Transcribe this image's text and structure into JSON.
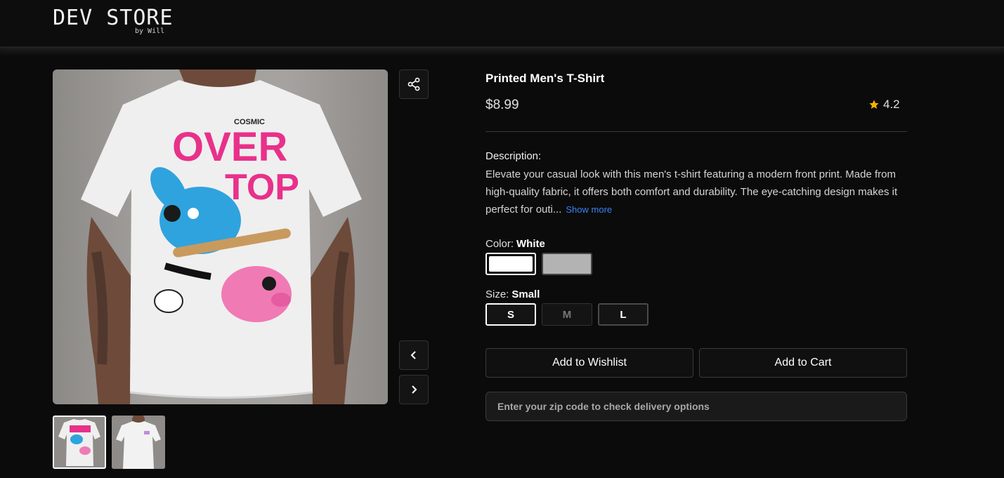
{
  "header": {
    "logo_title": "DEV STORE",
    "logo_subtitle": "by Will"
  },
  "product": {
    "title": "Printed Men's T-Shirt",
    "price": "$8.99",
    "rating": "4.2",
    "description_label": "Description:",
    "description_text": "Elevate your casual look with this men's t-shirt featuring a modern front print. Made from high-quality fabric, it offers both comfort and durability. The eye-catching design makes it perfect for outi...",
    "show_more_label": "Show more"
  },
  "shirt_print": {
    "word_top": "COSMIC",
    "word_over": "OVER",
    "word_top_2": "TOP"
  },
  "color": {
    "label": "Color:",
    "selected": "White",
    "options": [
      {
        "name": "White",
        "hex": "#ffffff"
      },
      {
        "name": "Grey",
        "hex": "#b3b3b3"
      }
    ]
  },
  "size": {
    "label": "Size:",
    "selected": "Small",
    "options": [
      "S",
      "M",
      "L"
    ]
  },
  "actions": {
    "wishlist_label": "Add to Wishlist",
    "cart_label": "Add to Cart"
  },
  "delivery": {
    "zip_placeholder": "Enter your zip code to check delivery options"
  },
  "icons": {
    "share": "share-icon",
    "prev": "chevron-left-icon",
    "next": "chevron-right-icon",
    "star": "star-icon"
  },
  "colors": {
    "background": "#0b0b0b",
    "accent_link": "#3b82f6",
    "star": "#f5b301",
    "print_pink": "#e8318a"
  }
}
